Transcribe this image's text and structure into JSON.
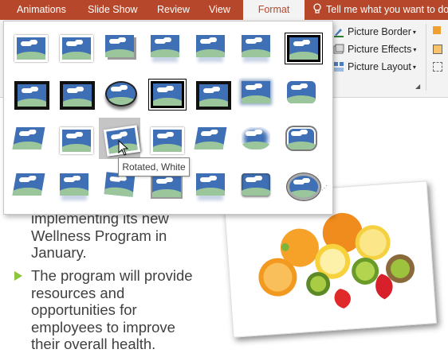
{
  "ribbon_tabs": [
    {
      "label": "Animations",
      "active": false
    },
    {
      "label": "Slide Show",
      "active": false
    },
    {
      "label": "Review",
      "active": false
    },
    {
      "label": "View",
      "active": false
    },
    {
      "label": "Format",
      "active": true
    }
  ],
  "tell_me": {
    "text": "Tell me what you want to do",
    "icon": "lightbulb-icon"
  },
  "picture_tools": {
    "border": {
      "label": "Picture Border",
      "icon": "pen-icon"
    },
    "effects": {
      "label": "Picture Effects",
      "icon": "effects-icon"
    },
    "layout": {
      "label": "Picture Layout",
      "icon": "layout-icon"
    }
  },
  "picture_styles_gallery": {
    "rows": 4,
    "columns": 7,
    "hovered_style": "Rotated, White",
    "tooltip": "Rotated, White"
  },
  "slide": {
    "paragraph1": "implementing its new\nWellness Program in\nJanuary.",
    "paragraph2": "The program will provide\nresources and\nopportunities for\nemployees to improve\ntheir overall health.",
    "bullet_color": "#8cc63e",
    "picture": "fruit-photo"
  },
  "colors": {
    "accent": "#b7472a",
    "ribbon_bg": "#f3f3f3",
    "text": "#404040"
  }
}
